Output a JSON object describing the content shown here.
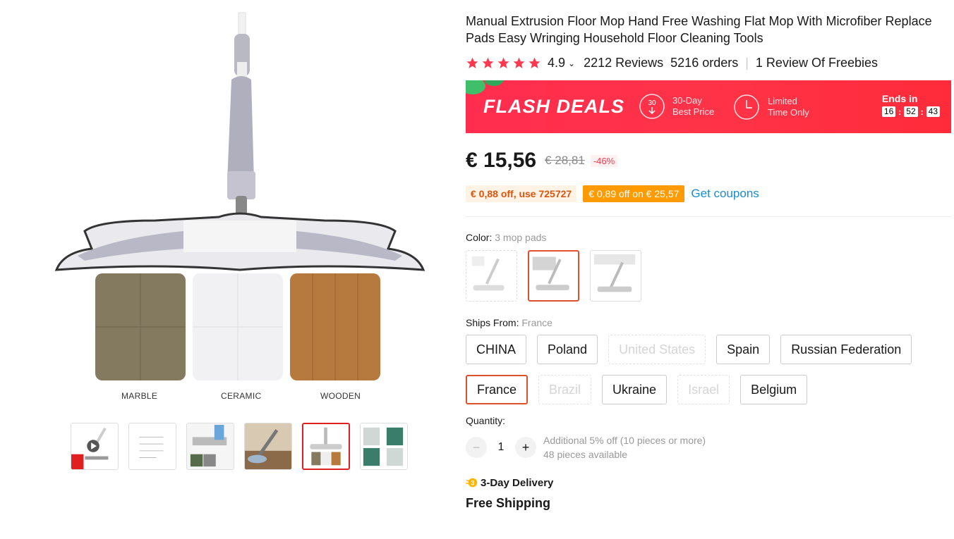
{
  "gallery": {
    "floor_labels": [
      "MARBLE",
      "CERAMIC",
      "WOODEN"
    ],
    "thumbnails": [
      "video",
      "dimensions",
      "pads",
      "use",
      "floors",
      "steps"
    ],
    "active_thumbnail": 4
  },
  "product": {
    "title": "Manual Extrusion Floor Mop Hand Free Washing Flat Mop With Microfiber Replace Pads Easy Wringing Household Floor Cleaning Tools",
    "rating": "4.9",
    "reviews": "2212 Reviews",
    "orders": "5216 orders",
    "freebies": "1 Review Of Freebies",
    "star_color": "#fd384f"
  },
  "flash": {
    "title": "FLASH DEALS",
    "feature1_icon_text": "30",
    "feature1_line1": "30-Day",
    "feature1_line2": "Best Price",
    "feature2_line1": "Limited",
    "feature2_line2": "Time Only",
    "ends_label": "Ends in",
    "hours": "16",
    "minutes": "52",
    "seconds": "43"
  },
  "price": {
    "current": "€ 15,56",
    "original": "€ 28,81",
    "discount": "-46%"
  },
  "coupons": {
    "code_coupon": "€ 0,88 off, use 725727",
    "store_coupon": "€ 0,89 off on € 25,57",
    "get_coupons": "Get coupons"
  },
  "color": {
    "label": "Color:",
    "value": "3 mop pads",
    "selected_index": 1
  },
  "ships_from": {
    "label": "Ships From:",
    "value": "France",
    "options": [
      {
        "label": "CHINA",
        "state": "normal"
      },
      {
        "label": "Poland",
        "state": "normal"
      },
      {
        "label": "United States",
        "state": "disabled"
      },
      {
        "label": "Spain",
        "state": "normal"
      },
      {
        "label": "Russian Federation",
        "state": "normal"
      },
      {
        "label": "France",
        "state": "active"
      },
      {
        "label": "Brazil",
        "state": "disabled"
      },
      {
        "label": "Ukraine",
        "state": "normal"
      },
      {
        "label": "Israel",
        "state": "disabled"
      },
      {
        "label": "Belgium",
        "state": "normal"
      }
    ]
  },
  "quantity": {
    "label": "Quantity:",
    "value": "1",
    "minus": "−",
    "plus": "+",
    "note1": "Additional 5% off (10 pieces or more)",
    "note2": "48 pieces available"
  },
  "delivery": {
    "badge": "3-Day Delivery",
    "shipping": "Free Shipping"
  }
}
